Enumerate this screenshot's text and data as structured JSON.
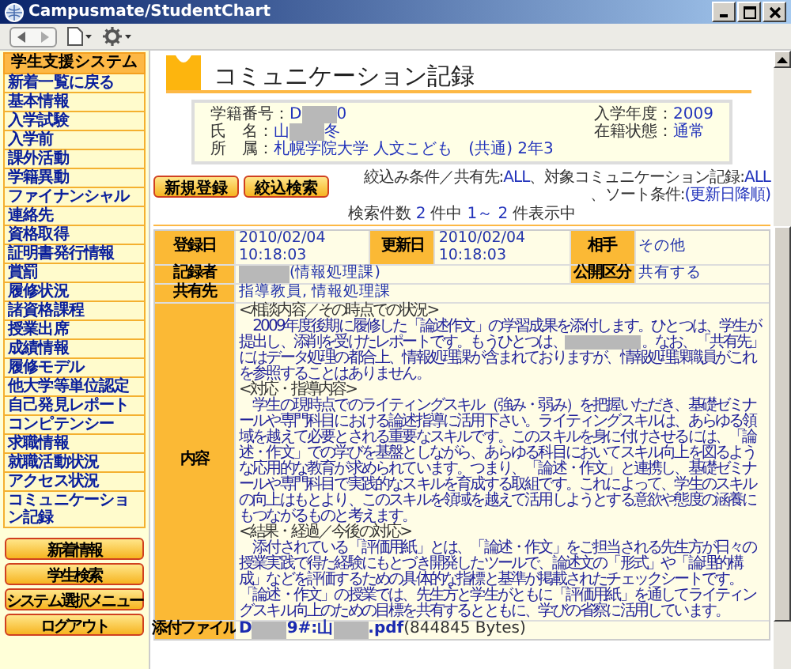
{
  "window": {
    "title": "Campusmate/StudentChart"
  },
  "sidebar": {
    "header": "学生支援システム",
    "items": [
      "新着一覧に戻る",
      "基本情報",
      "入学試験",
      "入学前",
      "課外活動",
      "学籍異動",
      "ファイナンシャル",
      "連絡先",
      "資格取得",
      "証明書発行情報",
      "賞罰",
      "履修状況",
      "諸資格課程",
      "授業出席",
      "成績情報",
      "履修モデル",
      "他大学等単位認定",
      "自己発見レポート",
      "コンピテンシー",
      "求職情報",
      "就職活動状況",
      "アクセス状況",
      "コミュニケーション記録"
    ],
    "buttons": [
      "新着情報",
      "学生検索",
      "システム選択メニュー",
      "ログアウト"
    ]
  },
  "page": {
    "title": "コミュニケーション記録"
  },
  "student": {
    "left": [
      {
        "label": "学籍番号：",
        "value": [
          {
            "kind": "text",
            "text": "D"
          },
          {
            "kind": "redacted"
          },
          {
            "kind": "text",
            "text": "0"
          }
        ]
      },
      {
        "label": "氏　名：",
        "value": [
          {
            "kind": "text",
            "text": "山"
          },
          {
            "kind": "redacted"
          },
          {
            "kind": "text",
            "text": "冬"
          }
        ]
      },
      {
        "label": "所　属：",
        "value": [
          {
            "kind": "text",
            "text": "札幌学院大学 人文こども　(共通) 2年3"
          }
        ]
      }
    ],
    "right": [
      {
        "label": "入学年度：",
        "value": [
          {
            "kind": "text",
            "text": "2009"
          }
        ]
      },
      {
        "label": "在籍状態：",
        "value": [
          {
            "kind": "text",
            "text": "通常"
          }
        ]
      }
    ]
  },
  "actions": [
    "新規登録",
    "絞込検索"
  ],
  "filter": [
    {
      "kind": "label",
      "text": "絞込み条件／共有先:"
    },
    {
      "kind": "value",
      "text": "ALL"
    },
    {
      "kind": "label",
      "text": "、対象コミュニケーション記録:"
    },
    {
      "kind": "value",
      "text": "ALL"
    },
    {
      "kind": "label",
      "text": "、ソート条件:"
    },
    {
      "kind": "value",
      "text": "(更新日降順)"
    }
  ],
  "count": [
    {
      "kind": "label",
      "text": "検索件数"
    },
    {
      "kind": "value",
      "text": "2"
    },
    {
      "kind": "label",
      "text": "件中"
    },
    {
      "kind": "value",
      "text": "1～ 2"
    },
    {
      "kind": "label",
      "text": "件表示中"
    }
  ],
  "record": {
    "rows": [
      {
        "fields": [
          {
            "label": "登録日",
            "kind": "text",
            "lines": [
              "2010/02/04",
              "10:18:03"
            ]
          },
          {
            "label": "更新日",
            "kind": "text",
            "lines": [
              "2010/02/04",
              "10:18:03"
            ]
          },
          {
            "label": "相手",
            "kind": "text",
            "lines": [
              "その他"
            ]
          }
        ]
      },
      {
        "fields": [
          {
            "label": "記録者",
            "kind": "text",
            "redacted": true,
            "lines": [
              "(情報処理課)"
            ]
          },
          {
            "label": "公開区分",
            "kind": "text",
            "lines": [
              "共有する"
            ]
          }
        ]
      },
      {
        "fields": [
          {
            "label": "共有先",
            "kind": "text",
            "lines": [
              "指導教員, 情報処理課"
            ]
          }
        ]
      },
      {
        "fields": [
          {
            "label": "内容",
            "kind": "content",
            "paragraphs": [
              {
                "kind": "heading",
                "segments": [
                  {
                    "kind": "text",
                    "text": "<相談内容／その時点での状況>"
                  }
                ]
              },
              {
                "kind": "body",
                "segments": [
                  {
                    "kind": "text",
                    "text": "　2009年度後期に履修した「論述作文」の学習成果を添付します。ひとつは、学生が提出し、添削を受けたレポートです。もうひとつは、"
                  },
                  {
                    "kind": "redacted"
                  },
                  {
                    "kind": "text",
                    "text": "。なお、「共有先」にはデータ処理の都合上、情報処理課が含まれておりますが、情報処理課職員がこれを参照することはありません。"
                  }
                ]
              },
              {
                "kind": "heading",
                "segments": [
                  {
                    "kind": "text",
                    "text": "<対応・指導内容>"
                  }
                ]
              },
              {
                "kind": "body",
                "segments": [
                  {
                    "kind": "text",
                    "text": "　学生の現時点でのライティングスキル（強み・弱み）を把握いただき、基礎ゼミナールや専門科目における論述指導に活用下さい。ライティングスキルは、あらゆる領域を越えて必要とされる重要なスキルです。このスキルを身に付けさせるには、「論述・作文」での学びを基盤としながら、あらゆる科目においてスキル向上を図るような応用的な教育が求められています。つまり、「論述・作文」と連携し、基礎ゼミナールや専門科目で実践的なスキルを育成する取組です。これによって、学生のスキルの向上はもとより、このスキルを領域を越えて活用しようとする意欲や態度の涵養にもつながるものと考えます。"
                  }
                ]
              },
              {
                "kind": "heading",
                "segments": [
                  {
                    "kind": "text",
                    "text": "<結果・経過／今後の対応>"
                  }
                ]
              },
              {
                "kind": "body",
                "segments": [
                  {
                    "kind": "text",
                    "text": "　添付されている「評価用紙」とは、「論述・作文」をご担当される先生方が日々の授業実践で得た経験にもとづき開発したツールで、論述文の「形式」や「論理的構成」などを評価するための具体的な指標と基準が掲載されたチェックシートです。「論述・作文」の授業では、先生方と学生がともに「評価用紙」を通してライティングスキル向上のための目標を共有するとともに、学びの省察に活用しています。"
                  }
                ]
              }
            ]
          }
        ]
      },
      {
        "fields": [
          {
            "label": "添付ファイル",
            "kind": "file",
            "segments": [
              {
                "kind": "link",
                "text": "D"
              },
              {
                "kind": "redacted"
              },
              {
                "kind": "link",
                "text": "9#:山"
              },
              {
                "kind": "redacted"
              },
              {
                "kind": "link",
                "text": ".pdf"
              },
              {
                "kind": "text",
                "text": "(844845 Bytes)"
              }
            ]
          }
        ]
      }
    ]
  }
}
